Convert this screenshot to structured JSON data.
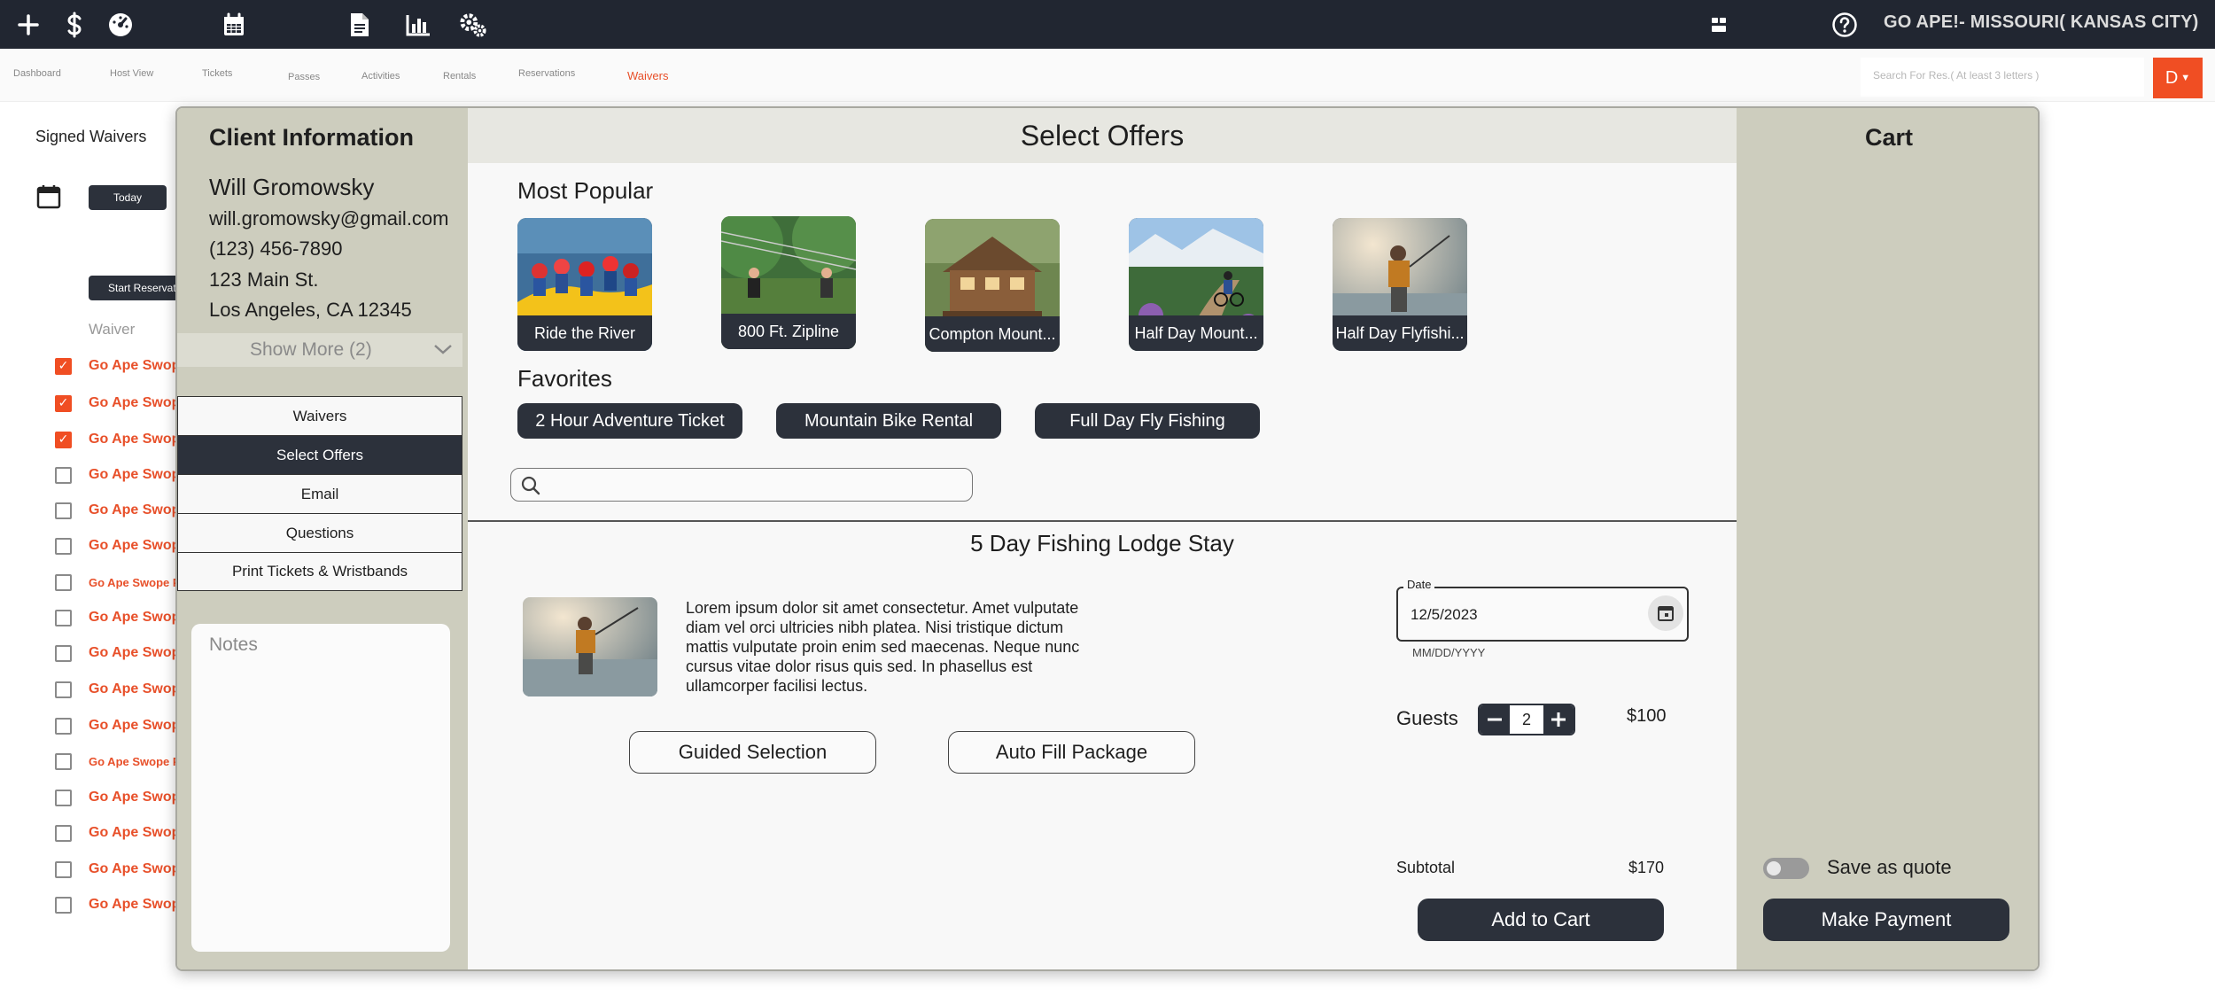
{
  "topbar": {
    "icons": [
      "plus-icon",
      "dollar-icon",
      "dashboard-gauge-icon",
      "calendar-icon",
      "document-icon",
      "chart-icon",
      "settings-gears-icon"
    ],
    "right_icons": [
      "layout-toggle-icon",
      "help-icon"
    ],
    "location": "GO APE!- MISSOURI( KANSAS CITY)"
  },
  "nav": {
    "items": [
      "Dashboard",
      "Host View",
      "Tickets",
      "Passes",
      "Activities",
      "Rentals",
      "Reservations",
      "Waivers"
    ],
    "active": "Waivers",
    "search_placeholder": "Search For Res.( At least 3 letters )",
    "user_initial": "D",
    "accent": "#f04e23"
  },
  "waivers_page": {
    "title": "Signed Waivers",
    "today_label": "Today",
    "start_res_label": "Start Reservation",
    "column_header": "Waiver",
    "rows": [
      {
        "name": "Go Ape Swope Park",
        "checked": true
      },
      {
        "name": "Go Ape Swope Park",
        "checked": true
      },
      {
        "name": "Go Ape Swope Park",
        "checked": true
      },
      {
        "name": "Go Ape Swope Park",
        "checked": false
      },
      {
        "name": "Go Ape Swope Park",
        "checked": false
      },
      {
        "name": "Go Ape Swope Park",
        "checked": false
      },
      {
        "name": "Go Ape Swope Park",
        "checked": false,
        "small": true
      },
      {
        "name": "Go Ape Swope Park",
        "checked": false
      },
      {
        "name": "Go Ape Swope Park",
        "checked": false
      },
      {
        "name": "Go Ape Swope Park",
        "checked": false
      },
      {
        "name": "Go Ape Swope Park",
        "checked": false
      },
      {
        "name": "Go Ape Swope Park",
        "checked": false,
        "small": true
      },
      {
        "name": "Go Ape Swope Park",
        "checked": false
      },
      {
        "name": "Go Ape Swope Park",
        "checked": false
      },
      {
        "name": "Go Ape Swope Park",
        "checked": false
      },
      {
        "name": "Go Ape Swope Park",
        "checked": false
      }
    ]
  },
  "client": {
    "title": "Client Information",
    "name": "Will Gromowsky",
    "email": "will.gromowsky@gmail.com",
    "phone": "(123) 456-7890",
    "address1": "123 Main St.",
    "address2": "Los Angeles, CA 12345",
    "show_more": "Show More (2)",
    "menu": [
      "Waivers",
      "Select Offers",
      "Email",
      "Questions",
      "Print Tickets & Wristbands"
    ],
    "menu_selected": "Select Offers",
    "notes_placeholder": "Notes"
  },
  "offers": {
    "title": "Select Offers",
    "most_popular_label": "Most Popular",
    "most_popular": [
      "Ride the River",
      "800 Ft. Zipline",
      "Compton Mount...",
      "Half Day Mount...",
      "Half Day Flyfishi..."
    ],
    "favorites_label": "Favorites",
    "favorites": [
      "2 Hour Adventure Ticket",
      "Mountain Bike Rental",
      "Full Day Fly Fishing"
    ]
  },
  "product": {
    "title": "5 Day Fishing Lodge Stay",
    "description": "Lorem ipsum dolor sit amet consectetur. Amet vulputate diam vel orci ultricies nibh platea. Nisi tristique dictum mattis vulputate proin enim sed maecenas. Neque nunc cursus vitae dolor risus quis sed. In phasellus est ullamcorper facilisi lectus.",
    "guided_label": "Guided Selection",
    "autofill_label": "Auto Fill Package",
    "date_label": "Date",
    "date_value": "12/5/2023",
    "date_hint": "MM/DD/YYYY",
    "guests_label": "Guests",
    "guests": "2",
    "price": "$100",
    "subtotal_label": "Subtotal",
    "subtotal": "$170",
    "add_to_cart": "Add to Cart"
  },
  "cart": {
    "title": "Cart",
    "save_quote_label": "Save as quote",
    "pay_label": "Make Payment"
  }
}
